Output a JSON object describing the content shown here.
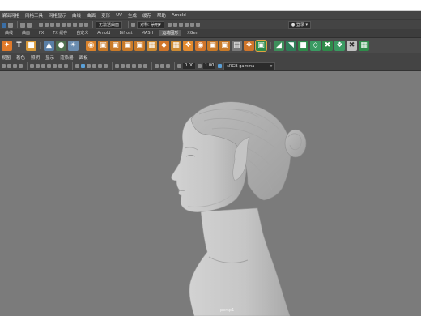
{
  "menubar": {
    "items": [
      "编辑网格",
      "网格工具",
      "网格显示",
      "曲线",
      "曲面",
      "变形",
      "UV",
      "生成",
      "缓存",
      "帮助",
      "Arnold"
    ]
  },
  "statusline": {
    "object_selector": "无激活曲面",
    "symmetry": "对称: 禁用",
    "login_label": "登录"
  },
  "shelf_tabs": {
    "items": [
      "曲线",
      "曲面",
      "FX",
      "FX 缓存",
      "自定义",
      "Arnold",
      "Bifrost",
      "MASH",
      "运动图形",
      "XGen"
    ]
  },
  "panel_menu": {
    "items": [
      "视图",
      "着色",
      "照明",
      "显示",
      "渲染器",
      "面板"
    ]
  },
  "panel_toolbar": {
    "gamma_value": "0.00",
    "exposure_value": "1.00",
    "color_space": "sRGB gamma"
  },
  "viewport": {
    "camera_label": "persp1",
    "background_color": "#7b7b7b",
    "model_color": "#c9c9c9"
  }
}
